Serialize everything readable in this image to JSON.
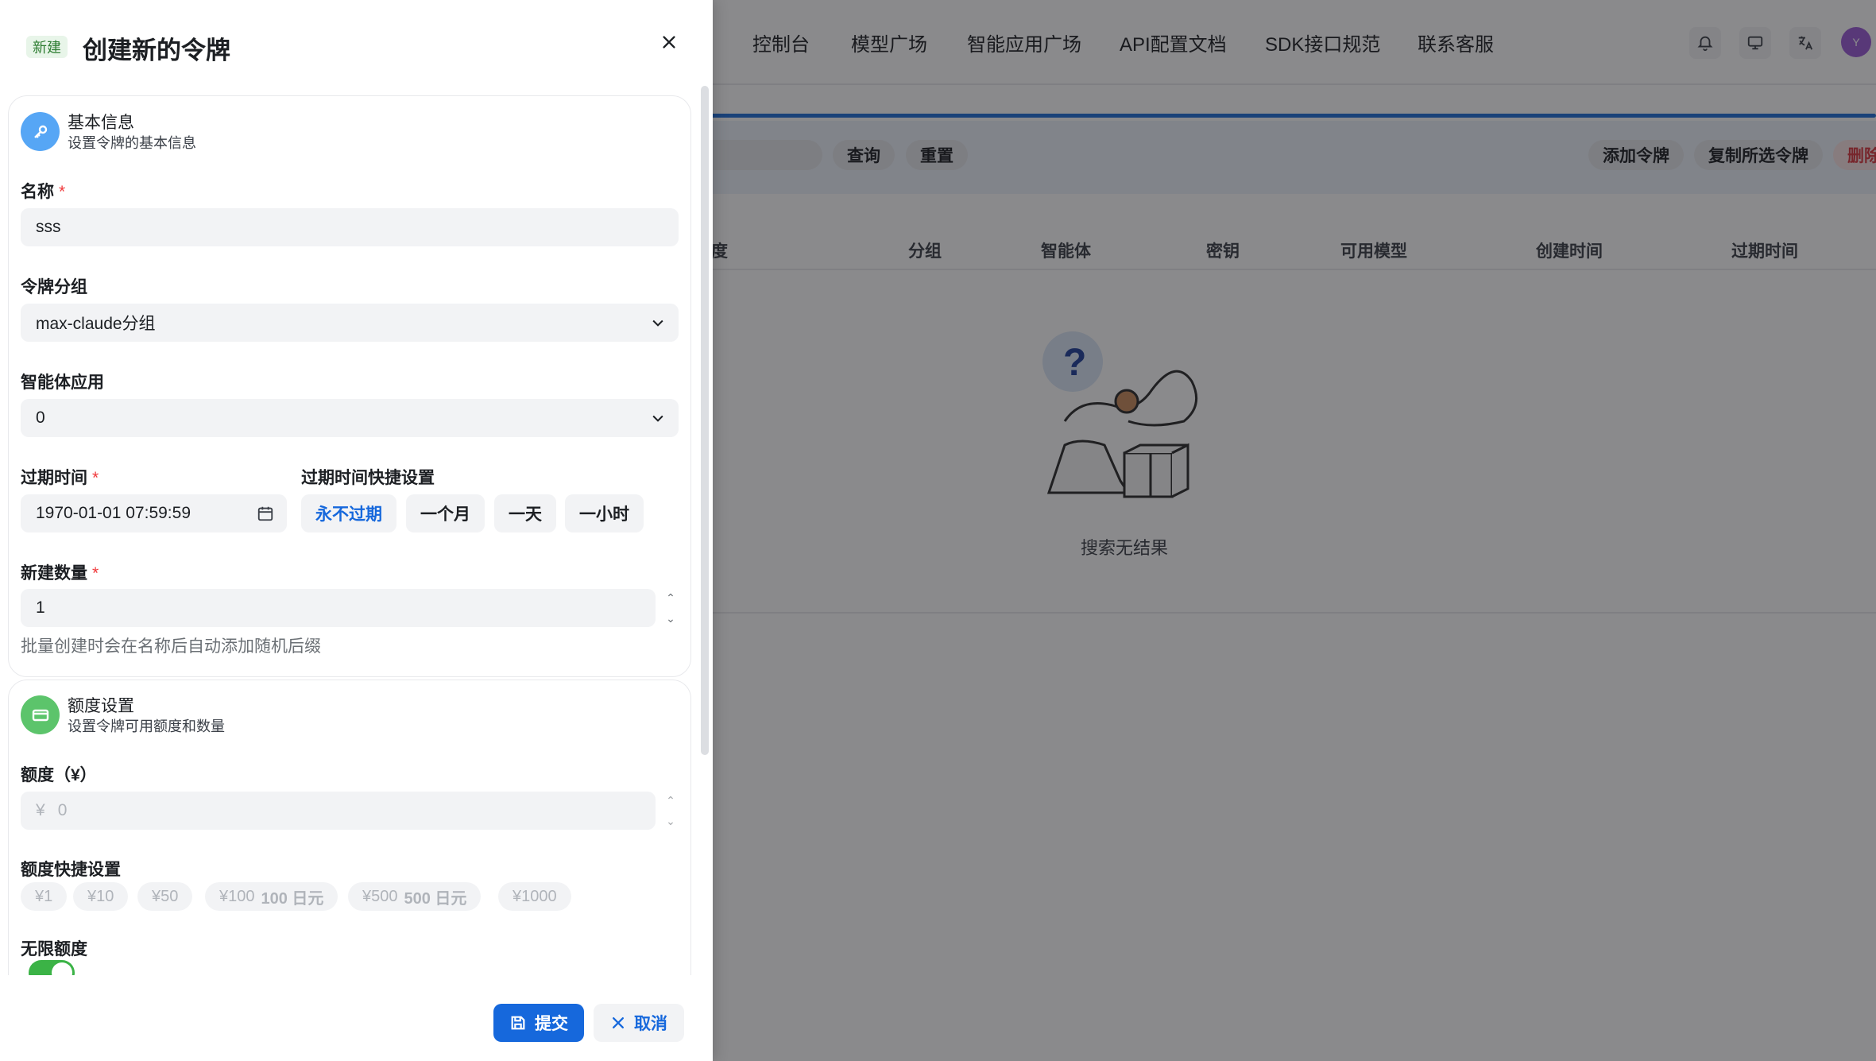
{
  "nav": [
    "控制台",
    "模型广场",
    "智能应用广场",
    "API配置文档",
    "SDK接口规范",
    "联系客服"
  ],
  "header_icons": [
    "bell-icon",
    "monitor-icon",
    "translate-icon"
  ],
  "avatar_letter": "Y",
  "toolbar": {
    "query": "查询",
    "reset": "重置",
    "add": "添加令牌",
    "copy": "复制所选令牌",
    "delete": "删除"
  },
  "table_headers": [
    "度",
    "分组",
    "智能体",
    "密钥",
    "可用模型",
    "创建时间",
    "过期时间"
  ],
  "empty_text": "搜索无结果",
  "sheet": {
    "tag": "新建",
    "title": "创建新的令牌",
    "basic": {
      "title": "基本信息",
      "subtitle": "设置令牌的基本信息",
      "name_label": "名称",
      "name_value": "sss",
      "group_label": "令牌分组",
      "group_value": "max-claude分组",
      "agent_label": "智能体应用",
      "agent_value": "0",
      "expire_label": "过期时间",
      "expire_value": "1970-01-01 07:59:59",
      "quick_label": "过期时间快捷设置",
      "quick": [
        "永不过期",
        "一个月",
        "一天",
        "一小时"
      ],
      "count_label": "新建数量",
      "count_value": "1",
      "count_hint": "批量创建时会在名称后自动添加随机后缀"
    },
    "quota": {
      "title": "额度设置",
      "subtitle": "设置令牌可用额度和数量",
      "amount_label": "额度（¥）",
      "currency": "¥",
      "amount_placeholder": "0",
      "quick_label": "额度快捷设置",
      "chips": [
        {
          "label": "¥1",
          "extra": ""
        },
        {
          "label": "¥10",
          "extra": ""
        },
        {
          "label": "¥50",
          "extra": ""
        },
        {
          "label": "¥100",
          "extra": "100 日元"
        },
        {
          "label": "¥500",
          "extra": "500 日元"
        },
        {
          "label": "¥1000",
          "extra": ""
        }
      ],
      "unlimited_label": "无限额度"
    },
    "submit": "提交",
    "cancel": "取消"
  }
}
